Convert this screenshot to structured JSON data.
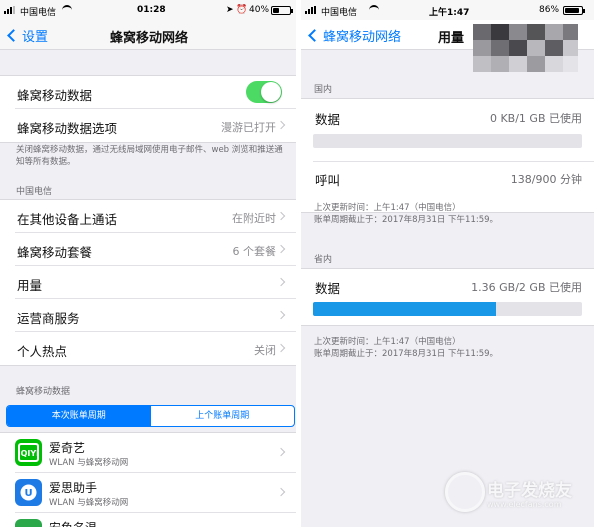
{
  "left": {
    "status": {
      "carrier": "中国电信",
      "time": "01:28",
      "battery": "40%",
      "battery_level": 0.4
    },
    "nav": {
      "back_label": "设置",
      "title": "蜂窝移动网络"
    },
    "main_group": {
      "cellular_data_label": "蜂窝移动数据",
      "cellular_data_on": true,
      "options_label": "蜂窝移动数据选项",
      "options_value": "漫游已打开"
    },
    "note": "关闭蜂窝移动数据，通过无线局域网使用电子邮件、web 浏览和推送通知等所有数据。",
    "carrier_header": "中国电信",
    "carrier_rows": [
      {
        "label": "在其他设备上通话",
        "value": "在附近时"
      },
      {
        "label": "蜂窝移动套餐",
        "value": "6 个套餐"
      },
      {
        "label": "用量",
        "value": ""
      },
      {
        "label": "运营商服务",
        "value": ""
      },
      {
        "label": "个人热点",
        "value": "关闭"
      }
    ],
    "data_header": "蜂窝移动数据",
    "segments": {
      "current": "本次账单周期",
      "previous": "上个账单周期"
    },
    "apps": [
      {
        "name": "爱奇艺",
        "sub": "WLAN 与蜂窝移动网",
        "icon": "iqiyi-icon",
        "color": "#00be06"
      },
      {
        "name": "爱思助手",
        "sub": "WLAN 与蜂窝移动网",
        "icon": "i4-assistant-icon",
        "color": "#1e7be6"
      },
      {
        "name": "安鱼名温",
        "sub": "",
        "icon": "app-icon",
        "color": "#2aa84a"
      }
    ]
  },
  "right": {
    "status": {
      "carrier": "中国电信",
      "time": "上午1:47",
      "battery": "86%",
      "battery_level": 0.86
    },
    "nav": {
      "back_label": "蜂窝移动网络",
      "title": "用量"
    },
    "domestic": {
      "header": "国内",
      "data_label": "数据",
      "data_value": "0 KB/1 GB 已使用",
      "data_fraction": 0.0,
      "calls_label": "呼叫",
      "calls_value": "138/900 分钟",
      "last_update": "上次更新时间：上午1:47（中国电信）",
      "period_end": "账单周期截止于：2017年8月31日 下午11:59。"
    },
    "province": {
      "header": "省内",
      "data_label": "数据",
      "data_value": "1.36 GB/2 GB 已使用",
      "data_fraction": 0.68,
      "last_update": "上次更新时间：上午1:47（中国电信）",
      "period_end": "账单周期截止于：2017年8月31日 下午11:59。"
    }
  },
  "watermark": {
    "main": "电子发烧友",
    "sub": "www.elecfans.com"
  }
}
